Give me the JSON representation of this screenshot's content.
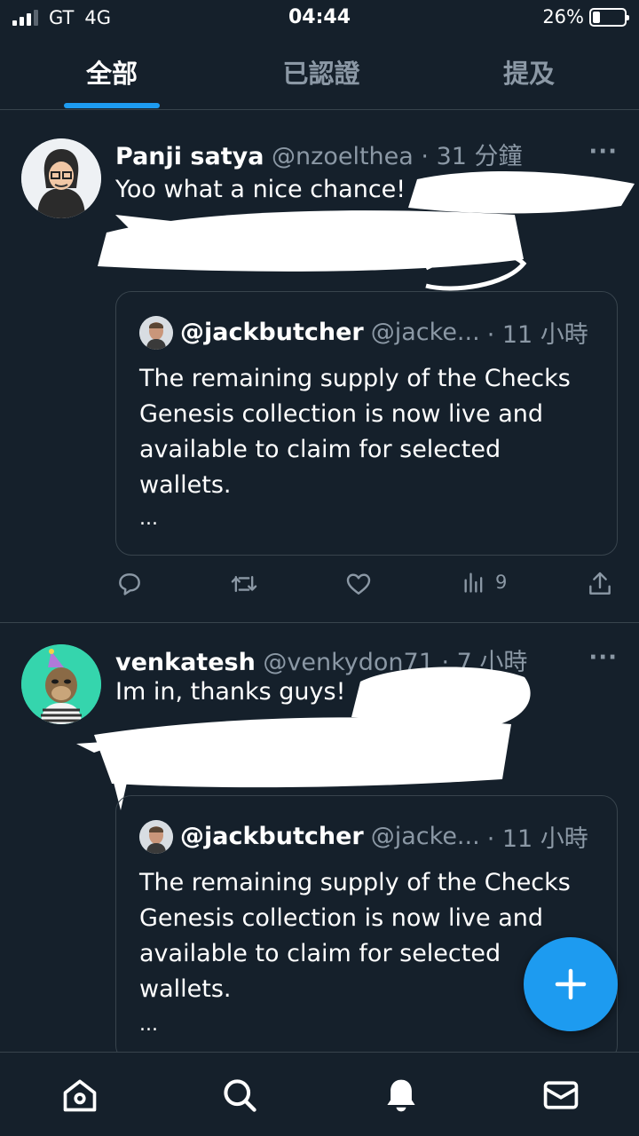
{
  "status_bar": {
    "carrier": "GT",
    "network": "4G",
    "time": "04:44",
    "battery": "26%"
  },
  "tabs": [
    {
      "label": "全部",
      "active": true
    },
    {
      "label": "已認證",
      "active": false
    },
    {
      "label": "提及",
      "active": false
    }
  ],
  "tweets": [
    {
      "name": "Panji satya",
      "handle": "@nzoelthea",
      "time": "· 31 分鐘",
      "more": "···",
      "text": "Yoo what a nice chance!",
      "quote": {
        "name": "@jackbutcher",
        "handle": "@jacke...",
        "time": "· 11 小時",
        "body": "The remaining supply of the Checks Genesis collection is now live and available to claim for selected wallets.",
        "ellipsis": "..."
      },
      "actions": {
        "views": "9"
      }
    },
    {
      "name": "venkatesh",
      "handle": "@venkydon71",
      "time": "· 7 小時",
      "more": "···",
      "text": "Im in, thanks guys!",
      "quote": {
        "name": "@jackbutcher",
        "handle": "@jacke...",
        "time": "· 11 小時",
        "body": "The remaining supply of the Checks Genesis collection is now live and available to claim for selected wallets.",
        "ellipsis": "..."
      }
    }
  ],
  "icons": {
    "reply": "reply-icon",
    "retweet": "retweet-icon",
    "like": "heart-icon",
    "views": "views-icon",
    "share": "share-icon",
    "compose": "plus-icon",
    "nav": [
      "home-icon",
      "search-icon",
      "bell-icon",
      "mail-icon"
    ]
  },
  "colors": {
    "background": "#15202b",
    "accent": "#1d9bf0",
    "muted_text": "#8b98a5",
    "border": "#38444d"
  }
}
